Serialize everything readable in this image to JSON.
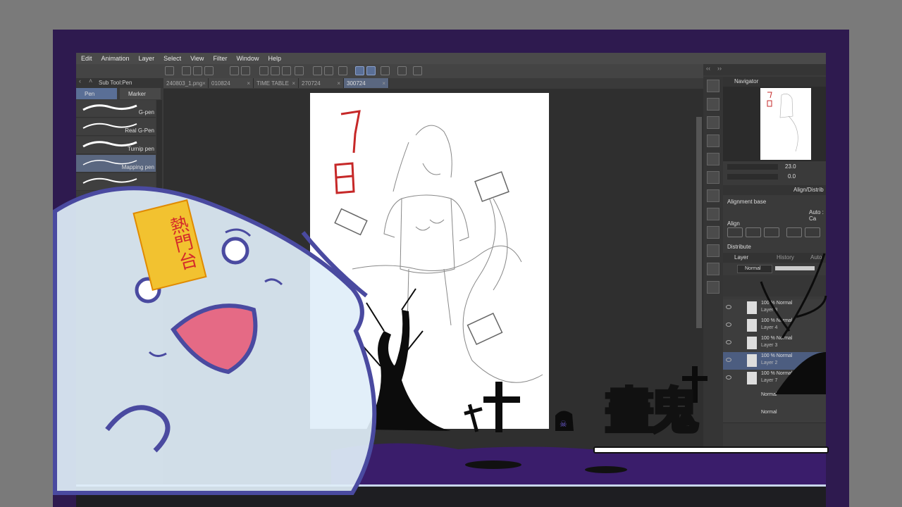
{
  "menu": [
    "Edit",
    "Animation",
    "Layer",
    "Select",
    "View",
    "Filter",
    "Window",
    "Help"
  ],
  "doc_tabs": [
    {
      "label": "240803_1.png",
      "active": false
    },
    {
      "label": "010824",
      "active": false
    },
    {
      "label": "TIME TABLE",
      "active": false
    },
    {
      "label": "270724",
      "active": false
    },
    {
      "label": "300724",
      "active": true
    }
  ],
  "subtool": {
    "header": "Sub Tool:Pen",
    "tabs": [
      "Pen",
      "Marker"
    ],
    "brushes": [
      {
        "name": "G-pen",
        "selected": false
      },
      {
        "name": "Real G-Pen",
        "selected": false
      },
      {
        "name": "Turnip pen",
        "selected": false
      },
      {
        "name": "Mapping pen",
        "selected": true
      }
    ]
  },
  "navigator": {
    "title": "Navigator",
    "zoom": "23.0",
    "angle": "0.0"
  },
  "align_panel": {
    "tab": "Align/Distrib",
    "alignment_base_label": "Alignment base",
    "auto_label": "Auto : Ca",
    "align_label": "Align",
    "distribute_label": "Distribute"
  },
  "layer_panel": {
    "tab_layer": "Layer",
    "tab_history": "History",
    "tab_auto": "Auto",
    "blend_mode": "Normal",
    "layers": [
      {
        "opacity": "100 % Normal",
        "name": "Layer 8",
        "selected": false
      },
      {
        "opacity": "100 % Normal",
        "name": "Layer 4",
        "selected": false
      },
      {
        "opacity": "100 % Normal",
        "name": "Layer 3",
        "selected": false
      },
      {
        "opacity": "100 % Normal",
        "name": "Layer 2",
        "selected": true
      },
      {
        "opacity": "100 % Normal",
        "name": "Layer 7",
        "selected": false
      }
    ],
    "extra_rows": [
      "Normal",
      "Normal"
    ]
  },
  "drawing": {
    "day_marker": "7日",
    "talisman_text": "熱門台"
  },
  "logo": {
    "text": "畫鬼"
  },
  "colors": {
    "frame_purple": "#2e1a4f",
    "accent_blue": "#5a6f96",
    "ghost_body": "#dfeef8",
    "ghost_outline": "#4a4aa0",
    "talisman_yellow": "#f2c230",
    "talisman_red": "#d42a2a"
  }
}
